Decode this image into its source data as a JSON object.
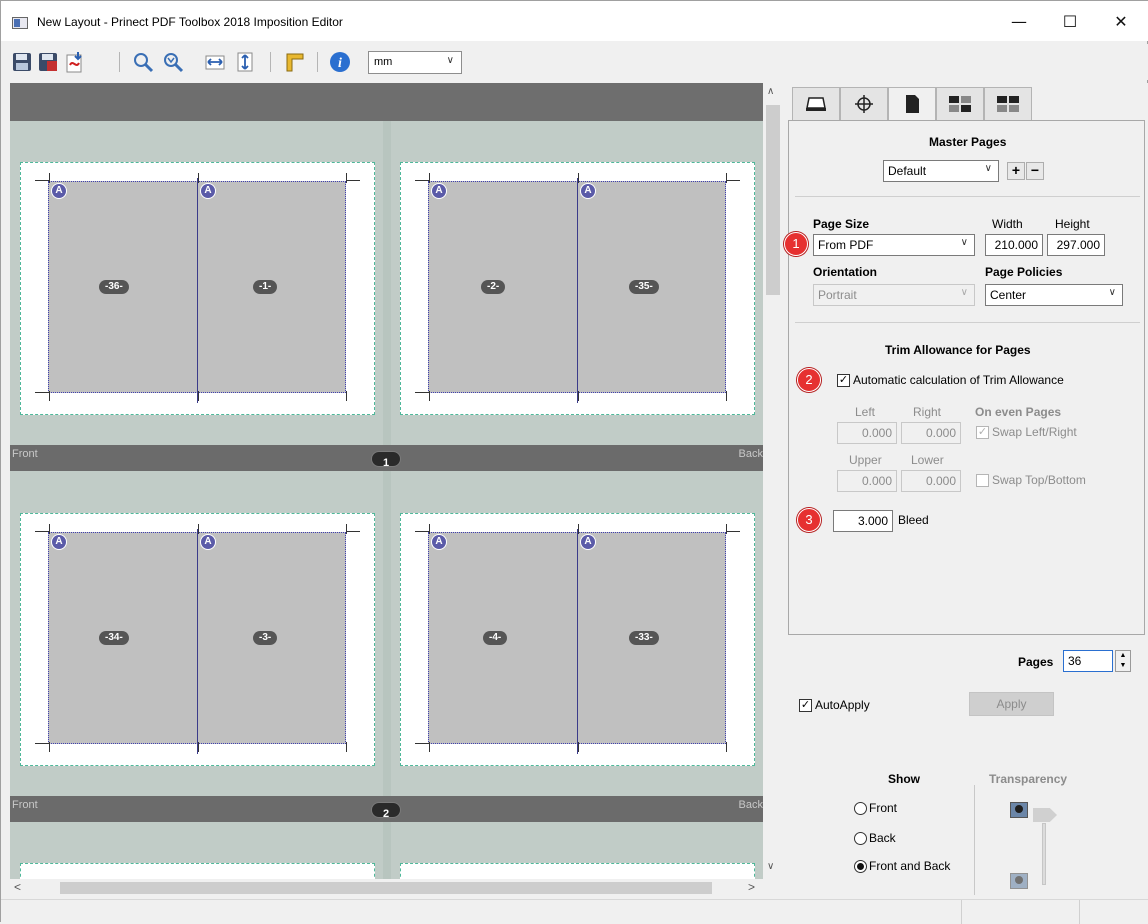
{
  "window": {
    "title": "New Layout - Prinect PDF Toolbox 2018 Imposition Editor",
    "minimize": "—",
    "maximize": "☐",
    "close": "✕"
  },
  "toolbar": {
    "icons": [
      "save-icon",
      "save-as-icon",
      "export-pdf-icon",
      "zoom-in-icon",
      "zoom-out-icon",
      "fit-width-icon",
      "fit-height-icon",
      "ruler-icon",
      "info-icon"
    ],
    "unit_value": "mm"
  },
  "canvas": {
    "sheets": [
      {
        "number": "1",
        "front_label": "Front",
        "back_label": "Back",
        "pages": [
          {
            "left_label": "-36-",
            "right_label": "-1-",
            "badge": "A"
          },
          {
            "left_label": "-2-",
            "right_label": "-35-",
            "badge": "A"
          }
        ]
      },
      {
        "number": "2",
        "front_label": "Front",
        "back_label": "Back",
        "pages": [
          {
            "left_label": "-34-",
            "right_label": "-3-",
            "badge": "A"
          },
          {
            "left_label": "-4-",
            "right_label": "-33-",
            "badge": "A"
          }
        ]
      }
    ]
  },
  "panel": {
    "tabs": [
      "sheet-tab",
      "marks-tab",
      "pages-tab",
      "layout-tab",
      "grid-tab"
    ],
    "master_pages": {
      "heading": "Master Pages",
      "value": "Default",
      "add": "+",
      "remove": "−"
    },
    "page_size": {
      "label": "Page Size",
      "value": "From PDF",
      "width_label": "Width",
      "height_label": "Height",
      "width": "210.000",
      "height": "297.000"
    },
    "orientation": {
      "label": "Orientation",
      "value": "Portrait"
    },
    "page_policies": {
      "label": "Page Policies",
      "value": "Center"
    },
    "trim": {
      "heading": "Trim Allowance for Pages",
      "auto_label": "Automatic calculation of Trim Allowance",
      "auto_checked": "✓",
      "left_label": "Left",
      "right_label": "Right",
      "upper_label": "Upper",
      "lower_label": "Lower",
      "left": "0.000",
      "right": "0.000",
      "upper": "0.000",
      "lower": "0.000",
      "even_label": "On even Pages",
      "swap_lr": "Swap Left/Right",
      "swap_lr_checked": "✓",
      "swap_tb": "Swap Top/Bottom"
    },
    "bleed": {
      "value": "3.000",
      "label": "Bleed"
    },
    "markers": [
      "1",
      "2",
      "3"
    ],
    "pages": {
      "label": "Pages",
      "value": "36"
    },
    "autoapply": {
      "label": "AutoApply",
      "checked": "✓"
    },
    "apply_label": "Apply",
    "show": {
      "heading": "Show",
      "options": [
        "Front",
        "Back",
        "Front and Back"
      ],
      "selected": "Front and Back"
    },
    "transparency_label": "Transparency"
  }
}
